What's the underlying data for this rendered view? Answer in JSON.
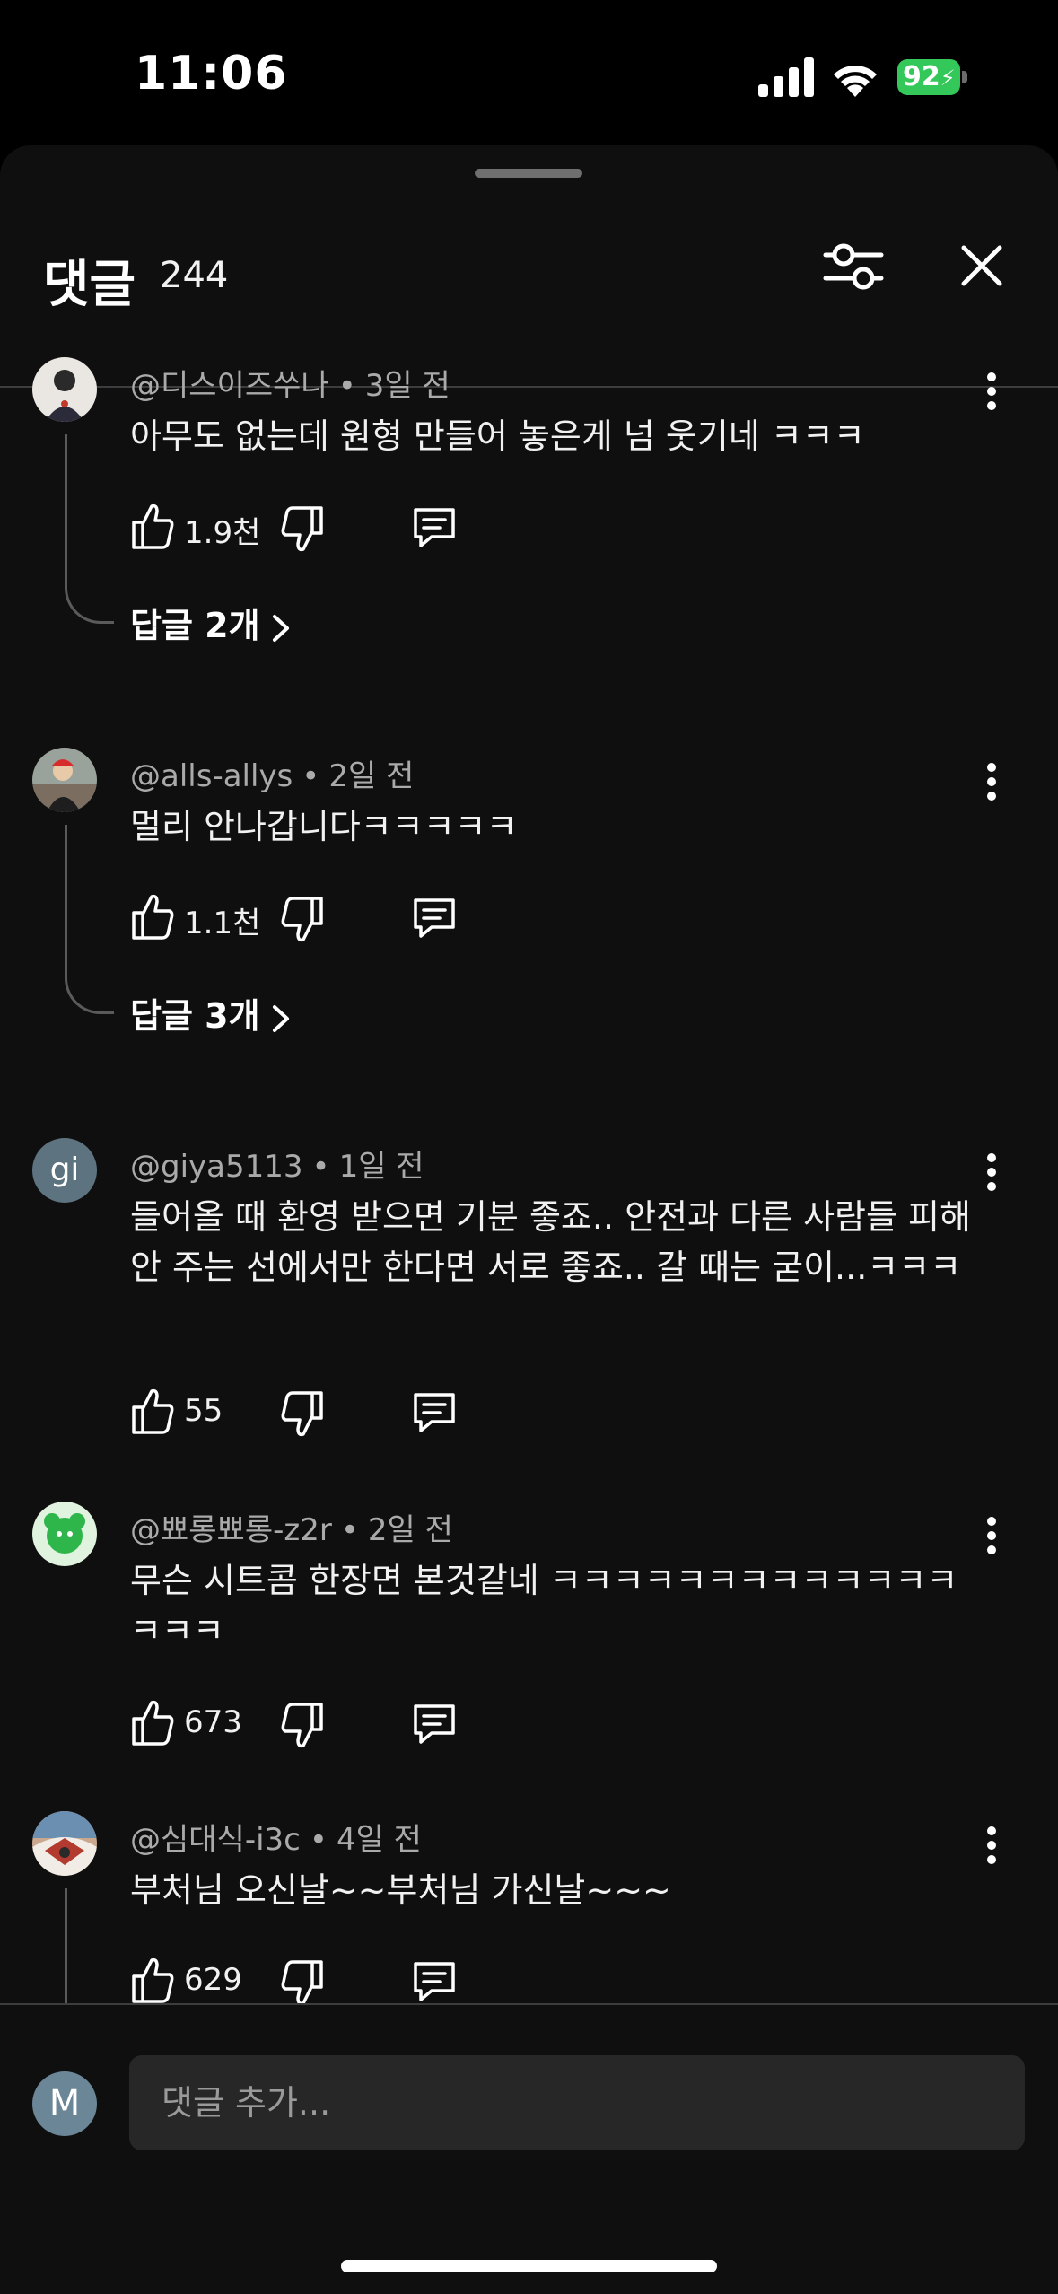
{
  "status_bar": {
    "time": "11:06",
    "battery": "92"
  },
  "header": {
    "title": "댓글",
    "count": "244"
  },
  "comments": [
    {
      "user": "@디스이즈쑤나",
      "age": "3일 전",
      "text": "아무도 없는데 원형 만들어 놓은게 넘 웃기네 ㅋㅋㅋ",
      "likes": "1.9천",
      "replies": "답글 2개"
    },
    {
      "user": "@alls-allys",
      "age": "2일 전",
      "text": "멀리 안나갑니다ㅋㅋㅋㅋㅋ",
      "likes": "1.1천",
      "replies": "답글 3개"
    },
    {
      "user": "@giya5113",
      "age": "1일 전",
      "avatar_letter": "gi",
      "text": "들어올 때 환영 받으면 기분 좋죠.. 안전과 다른 사람들 피해 안 주는 선에서만 한다면 서로 좋죠.. 갈 때는 굳이...ㅋㅋㅋ",
      "likes": "55"
    },
    {
      "user": "@뾰롱뾰롱-z2r",
      "age": "2일 전",
      "text": "무슨 시트콤 한장면 본것같네 ㅋㅋㅋㅋㅋㅋㅋㅋㅋㅋㅋㅋㅋㅋㅋㅋ",
      "likes": "673"
    },
    {
      "user": "@심대식-i3c",
      "age": "4일 전",
      "text": "부처님 오신날~~부처님 가신날~~~",
      "likes": "629"
    }
  ],
  "composer": {
    "avatar_letter": "M",
    "placeholder": "댓글 추가..."
  },
  "colors": {
    "background": "#0f0f0f",
    "battery": "#34c759",
    "secondary_text": "#aaaaaa"
  },
  "icons": [
    "signal-icon",
    "wifi-icon",
    "battery-icon",
    "filter-icon",
    "close-icon",
    "like-icon",
    "dislike-icon",
    "reply-icon",
    "more-icon",
    "chevron-right-icon"
  ]
}
